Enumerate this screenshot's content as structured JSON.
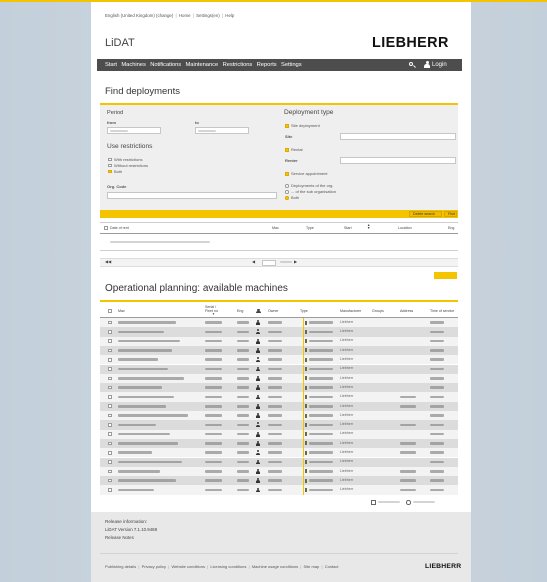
{
  "topbar": {
    "links": [
      "English (United Kingdom) (change)",
      "Home",
      "Settings(en)",
      "Help"
    ]
  },
  "brand": {
    "app": "LiDAT",
    "logo": "LIEBHERR"
  },
  "nav": {
    "items": [
      "Start",
      "Machines",
      "Notifications",
      "Maintenance",
      "Restrictions",
      "Reports",
      "Settings"
    ],
    "login": "Login",
    "icons": [
      "search-icon",
      "user-icon"
    ]
  },
  "find": {
    "title": "Find deployments",
    "period": {
      "title": "Period",
      "from": "from",
      "to": "to"
    },
    "restrictions": {
      "title": "Use restrictions",
      "options": [
        "With restrictions",
        "Without restrictions",
        "Both"
      ],
      "selected": "Both"
    },
    "org_code": "Org. Code",
    "deployment": {
      "title": "Deployment type",
      "site_deployment": "Site deployment",
      "site": "Site",
      "rental": "Rental",
      "renter": "Renter",
      "service": "Service appointment",
      "scope": [
        "Deployments of the org.",
        "... of the sub organisation",
        "Both"
      ]
    },
    "buttons": {
      "delete": "Delete search",
      "find": "Find"
    },
    "table_headers": [
      "Date of rent",
      "Mac",
      "Type",
      "Start",
      "Location",
      "Eng"
    ]
  },
  "available": {
    "title": "Operational planning: available machines",
    "headers": [
      "Mac",
      "Serial / Fleet no",
      "Eng",
      "Owner",
      "Type",
      "Manufacturer",
      "Groups",
      "Address",
      "Time of service"
    ],
    "rows": [
      {
        "manufacturer": "Liebherr"
      },
      {
        "manufacturer": "Liebherr"
      },
      {
        "manufacturer": "Liebherr"
      },
      {
        "manufacturer": "Liebherr"
      },
      {
        "manufacturer": "Liebherr"
      },
      {
        "manufacturer": "Liebherr"
      },
      {
        "manufacturer": "Liebherr"
      },
      {
        "manufacturer": "Liebherr"
      },
      {
        "manufacturer": "Liebherr"
      },
      {
        "manufacturer": "Liebherr"
      },
      {
        "manufacturer": "Liebherr"
      },
      {
        "manufacturer": "Liebherr"
      },
      {
        "manufacturer": "Liebherr"
      },
      {
        "manufacturer": "Liebherr"
      },
      {
        "manufacturer": "Liebherr"
      },
      {
        "manufacturer": "Liebherr"
      },
      {
        "manufacturer": "Liebherr"
      },
      {
        "manufacturer": "Liebherr"
      },
      {
        "manufacturer": "Liebherr"
      }
    ]
  },
  "footer": {
    "release_title": "Release information:",
    "version": "LiDAT Version 7.1.10.9488",
    "release_notes": "Release Notes",
    "links": [
      "Publishing details",
      "Privacy policy",
      "Website conditions",
      "Licensing conditions",
      "Machine usage conditions",
      "Site map",
      "Contact"
    ],
    "logo": "LIEBHERR"
  },
  "colors": {
    "accent": "#f5c400",
    "nav": "#4d4d4d",
    "panel": "#efefef"
  }
}
